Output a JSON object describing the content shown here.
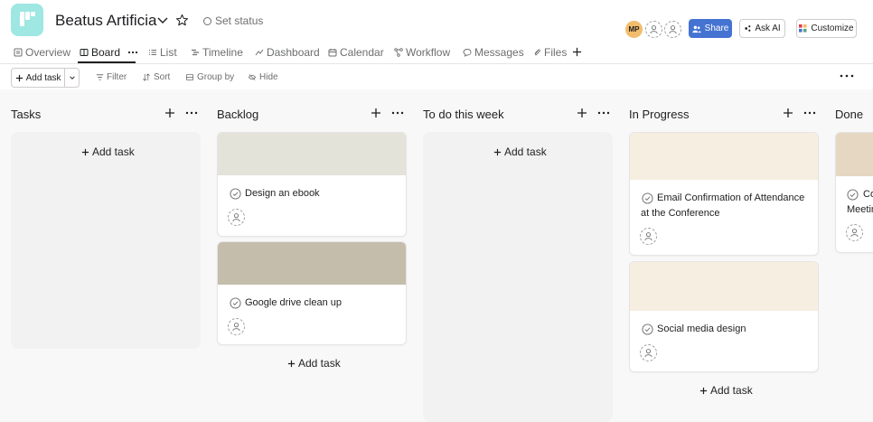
{
  "project": {
    "title": "Beatus Artificia",
    "set_status": "Set status"
  },
  "header_actions": {
    "avatar_initials": "MP",
    "share": "Share",
    "ask_ai": "Ask AI",
    "customize": "Customize"
  },
  "tabs": [
    {
      "label": "Overview",
      "icon": "overview-icon"
    },
    {
      "label": "Board",
      "icon": "board-icon",
      "active": true
    },
    {
      "label": "List",
      "icon": "list-icon"
    },
    {
      "label": "Timeline",
      "icon": "timeline-icon"
    },
    {
      "label": "Dashboard",
      "icon": "dashboard-icon"
    },
    {
      "label": "Calendar",
      "icon": "calendar-icon"
    },
    {
      "label": "Workflow",
      "icon": "workflow-icon"
    },
    {
      "label": "Messages",
      "icon": "messages-icon"
    },
    {
      "label": "Files",
      "icon": "files-icon"
    }
  ],
  "toolbar": {
    "add_task": "Add task",
    "filter": "Filter",
    "sort": "Sort",
    "group_by": "Group by",
    "hide": "Hide"
  },
  "columns": [
    {
      "name": "Tasks",
      "add_task": "Add task",
      "cards": []
    },
    {
      "name": "Backlog",
      "add_task": "Add task",
      "cards": [
        {
          "title": "Design an ebook",
          "cover": "#e4e3d9"
        },
        {
          "title": "Google drive clean up",
          "cover": "#c5bdac"
        }
      ]
    },
    {
      "name": "To do this week",
      "add_task": "Add task",
      "cards": []
    },
    {
      "name": "In Progress",
      "add_task": "Add task",
      "cards": [
        {
          "title": "Email Confirmation of Attendance at the Conference",
          "cover": "#f6eee0"
        },
        {
          "title": "Social media design",
          "cover": "#f6eee0"
        }
      ]
    },
    {
      "name": "Done",
      "cards": [
        {
          "title": "Co Meetin",
          "cover": "#e5d7c1"
        }
      ]
    }
  ],
  "colors": {
    "share_button": "#4573d2",
    "logo_bg": "#9ee7e3",
    "avatar_bg": "#f1bd6c"
  }
}
